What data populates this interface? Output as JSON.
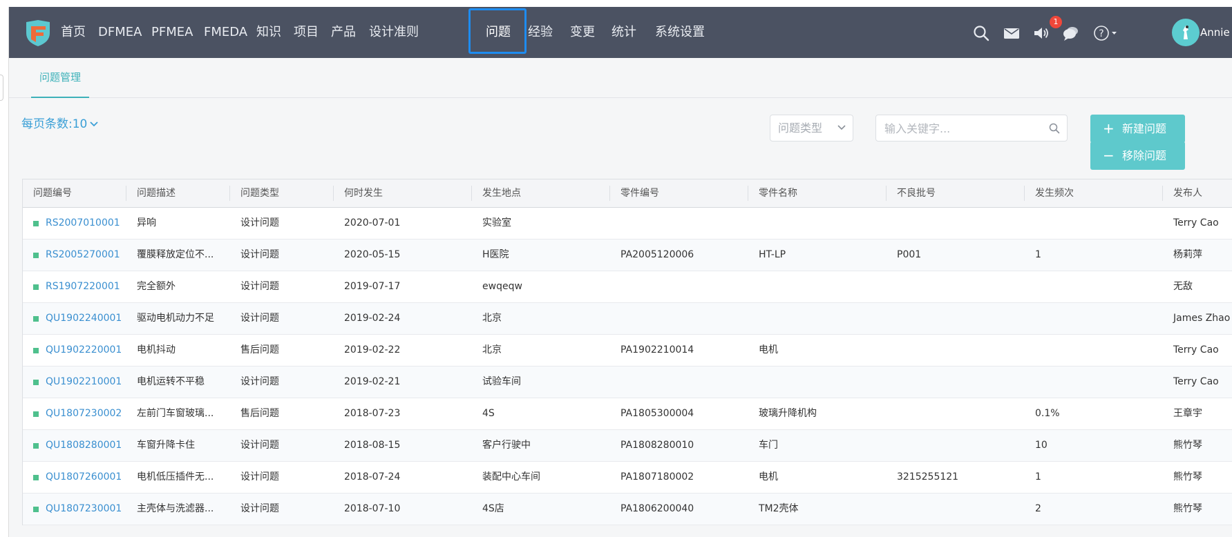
{
  "nav": {
    "items": [
      "首页",
      "DFMEA",
      "PFMEA",
      "FMEDA",
      "知识",
      "项目",
      "产品",
      "设计准则",
      "问题",
      "经验",
      "变更",
      "统计",
      "系统设置"
    ],
    "active_index": 8,
    "notification_badge": "1",
    "username": "Annie",
    "icons": [
      "search-icon",
      "mail-icon",
      "speaker-icon",
      "chat-icon",
      "help-icon"
    ]
  },
  "tabs": {
    "active": "问题管理"
  },
  "toolbar": {
    "page_size_label": "每页条数:10",
    "type_select_placeholder": "问题类型",
    "search_placeholder": "输入关键字...",
    "new_button": "新建问题",
    "remove_button": "移除问题"
  },
  "table": {
    "columns": [
      "问题编号",
      "问题描述",
      "问题类型",
      "何时发生",
      "发生地点",
      "零件编号",
      "零件名称",
      "不良批号",
      "发生频次",
      "发布人"
    ],
    "rows": [
      [
        "RS2007010001",
        "异响",
        "设计问题",
        "2020-07-01",
        "实验室",
        "",
        "",
        "",
        "",
        "Terry Cao"
      ],
      [
        "RS2005270001",
        "覆膜释放定位不...",
        "设计问题",
        "2020-05-15",
        "H医院",
        "PA2005120006",
        "HT-LP",
        "P001",
        "1",
        "杨莉萍"
      ],
      [
        "RS1907220001",
        "完全额外",
        "设计问题",
        "2019-07-17",
        "ewqeqw",
        "",
        "",
        "",
        "",
        "无敌"
      ],
      [
        "QU1902240001",
        "驱动电机动力不足",
        "设计问题",
        "2019-02-24",
        "北京",
        "",
        "",
        "",
        "",
        "James Zhao"
      ],
      [
        "QU1902220001",
        "电机抖动",
        "售后问题",
        "2019-02-22",
        "北京",
        "PA1902210014",
        "电机",
        "",
        "",
        "Terry Cao"
      ],
      [
        "QU1902210001",
        "电机运转不平稳",
        "设计问题",
        "2019-02-21",
        "试验车间",
        "",
        "",
        "",
        "",
        "Terry Cao"
      ],
      [
        "QU1807230002",
        "左前门车窗玻璃...",
        "售后问题",
        "2018-07-23",
        "4S",
        "PA1805300004",
        "玻璃升降机构",
        "",
        "0.1%",
        "王章宇"
      ],
      [
        "QU1808280001",
        "车窗升降卡住",
        "设计问题",
        "2018-08-15",
        "客户行驶中",
        "PA1808280010",
        "车门",
        "",
        "10",
        "熊竹琴"
      ],
      [
        "QU1807260001",
        "电机低压插件无...",
        "设计问题",
        "2018-07-24",
        "装配中心车间",
        "PA1807180002",
        "电机",
        "3215255121",
        "1",
        "熊竹琴"
      ],
      [
        "QU1807230001",
        "主壳体与洗滤器...",
        "设计问题",
        "2018-07-10",
        "4S店",
        "PA1806200040",
        "TM2壳体",
        "",
        "2",
        "熊竹琴"
      ]
    ]
  },
  "colors": {
    "navbar": "#4b5262",
    "accent": "#5ec9cc",
    "link": "#3a8fd0",
    "status_dot": "#4fc08d",
    "active_outline": "#1e8cf0"
  }
}
